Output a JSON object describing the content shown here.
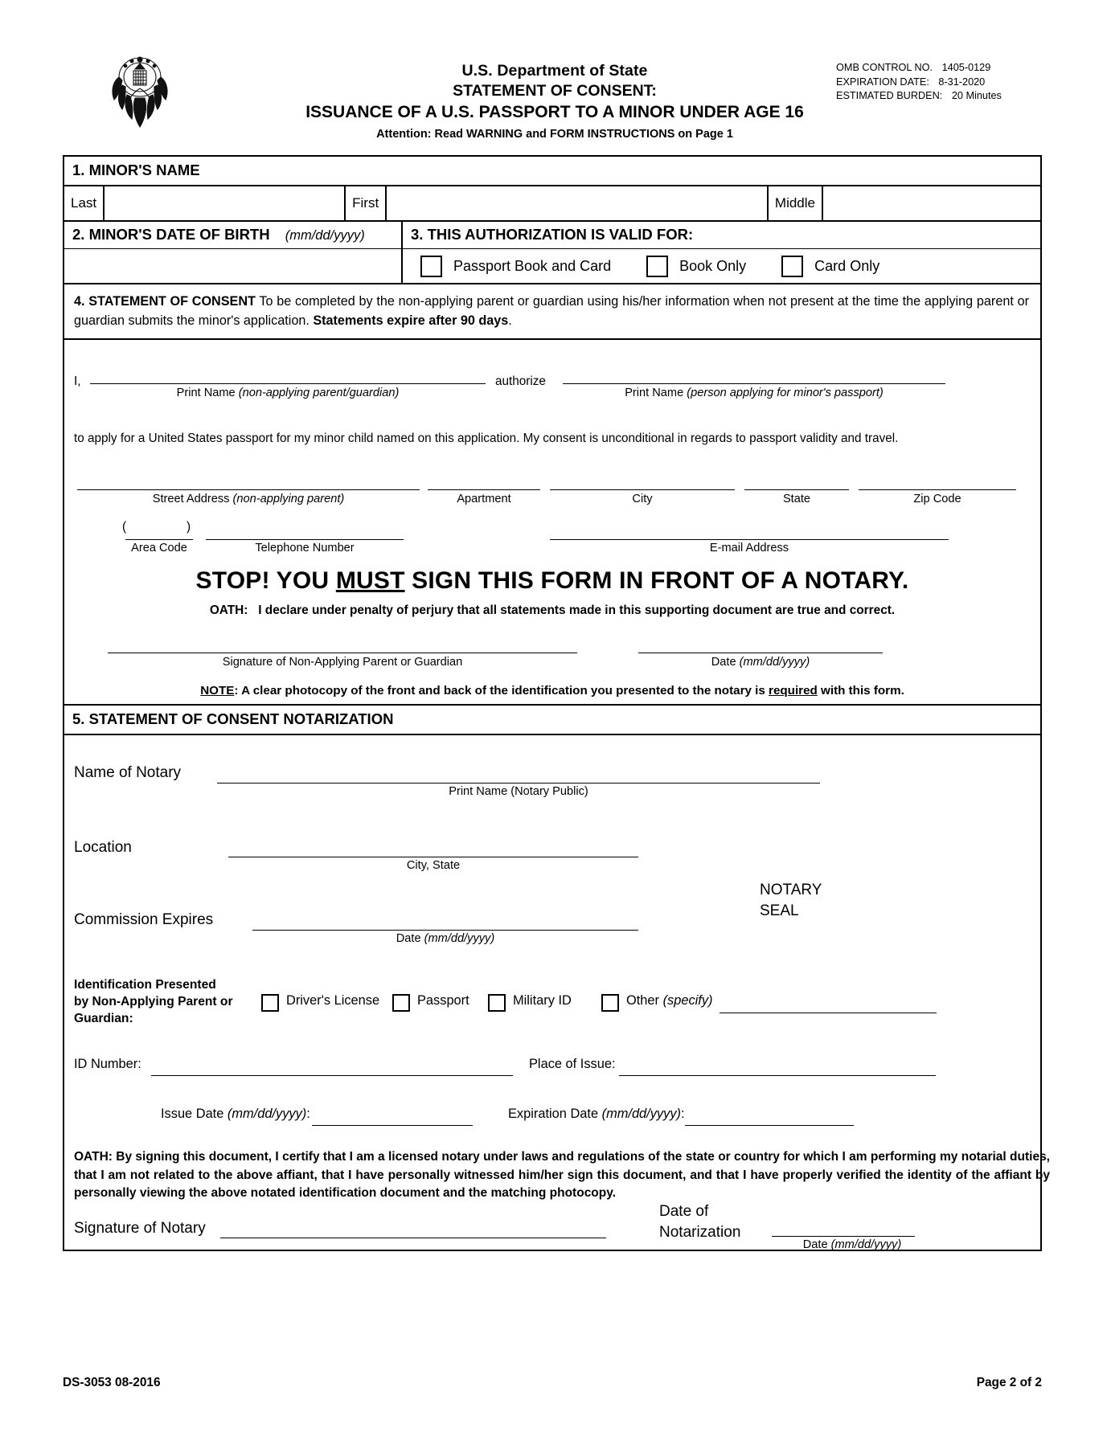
{
  "header": {
    "agency": "U.S. Department of State",
    "title_line1": "STATEMENT OF CONSENT:",
    "title_line2": "ISSUANCE OF A U.S. PASSPORT TO A MINOR UNDER AGE 16",
    "attention": "Attention: Read WARNING and FORM INSTRUCTIONS on Page 1",
    "omb": {
      "control_label": "OMB  CONTROL  NO.",
      "control_value": "1405-0129",
      "expiration_label": "EXPIRATION    DATE:",
      "expiration_value": "8-31-2020",
      "burden_label": "ESTIMATED BURDEN:",
      "burden_value": "20 Minutes"
    }
  },
  "section1": {
    "title": "1. MINOR'S NAME",
    "last_label": "Last",
    "first_label": "First",
    "middle_label": "Middle",
    "last_value": "",
    "first_value": "",
    "middle_value": ""
  },
  "section2": {
    "title": "2. MINOR'S DATE OF BIRTH",
    "format_hint": "(mm/dd/yyyy)",
    "value": ""
  },
  "section3": {
    "title": "3. THIS AUTHORIZATION IS VALID FOR:",
    "options": [
      {
        "label": "Passport Book and Card",
        "checked": false
      },
      {
        "label": "Book Only",
        "checked": false
      },
      {
        "label": "Card Only",
        "checked": false
      }
    ]
  },
  "section4": {
    "title": "4. STATEMENT OF CONSENT",
    "intro_text": "To be completed by the non-applying parent or guardian using his/her information when not present at the time the applying parent or guardian submits the minor's application.",
    "intro_bold": "Statements expire after 90 days",
    "intro_bold_tail": ".",
    "i_label": "I,",
    "authorize_label": "authorize",
    "print_name_1_pre": "Print Name",
    "print_name_1_ital": "(non-applying parent/guardian)",
    "print_name_2_pre": "Print Name",
    "print_name_2_ital": "(person applying for minor's passport)",
    "consent_text": "to apply for a United States passport for my minor child named on this application. My consent is unconditional in regards to passport validity and travel.",
    "address_caption_pre": "Street Address",
    "address_caption_ital": "(non-applying parent)",
    "apartment_label": "Apartment",
    "city_label": "City",
    "state_label": "State",
    "zip_label": "Zip Code",
    "area_code_label": "Area Code",
    "telephone_label": "Telephone Number",
    "email_label": "E-mail Address",
    "paren_open": "(",
    "paren_close": ")",
    "stop_pre": "STOP! YOU ",
    "stop_must": "MUST",
    "stop_post": " SIGN THIS FORM IN FRONT OF A NOTARY.",
    "oath_label": "OATH:",
    "oath_text": "I declare under penalty of perjury that all statements made in this supporting document are true and correct.",
    "signature_label": "Signature of Non-Applying Parent or Guardian",
    "date_label_pre": "Date",
    "date_label_ital": "(mm/dd/yyyy)",
    "note_label": "NOTE",
    "note_text_a": ": A clear photocopy of the front and back of the identification you presented to the notary is ",
    "note_required": "required",
    "note_text_b": " with this form."
  },
  "section5": {
    "title": "5. STATEMENT OF CONSENT NOTARIZATION",
    "name_of_notary_label": "Name of Notary",
    "name_of_notary_caption": "Print Name (Notary Public)",
    "location_label": "Location",
    "location_caption": "City,  State",
    "commission_expires_label": "Commission Expires",
    "commission_caption_pre": "Date",
    "commission_caption_ital": "(mm/dd/yyyy)",
    "notary_seal_line1": "NOTARY",
    "notary_seal_line2": "SEAL",
    "id_presented_line1": "Identification Presented",
    "id_presented_line2": "by Non-Applying Parent or",
    "id_presented_line3": "Guardian:",
    "id_options": [
      {
        "label": "Driver's License",
        "checked": false
      },
      {
        "label": "Passport",
        "checked": false
      },
      {
        "label": "Military ID",
        "checked": false
      }
    ],
    "id_other_label": "Other",
    "id_other_ital": "(specify)",
    "id_number_label": "ID Number:",
    "place_of_issue_label": "Place of Issue:",
    "issue_date_pre": "Issue Date ",
    "issue_date_ital": "(mm/dd/yyyy)",
    "issue_date_post": ":",
    "expiration_date_pre": "Expiration Date ",
    "expiration_date_ital": "(mm/dd/yyyy)",
    "expiration_date_post": ":",
    "notary_oath": "OATH: By signing this document, I certify that I am a licensed notary under laws and regulations of the state or country for which I am performing my notarial duties, that I am not related to the above affiant, that I have personally witnessed him/her sign this document, and that I have properly verified the identity of the affiant by personally viewing the above notated identification document and the matching photocopy.",
    "signature_of_notary_label": "Signature of Notary",
    "date_of_label_line1": "Date of",
    "date_of_label_line2": "Notarization",
    "date_of_caption_pre": "Date",
    "date_of_caption_ital": "(mm/dd/yyyy)"
  },
  "footer": {
    "form_id": "DS-3053   08-2016",
    "page": "Page 2 of 2"
  }
}
